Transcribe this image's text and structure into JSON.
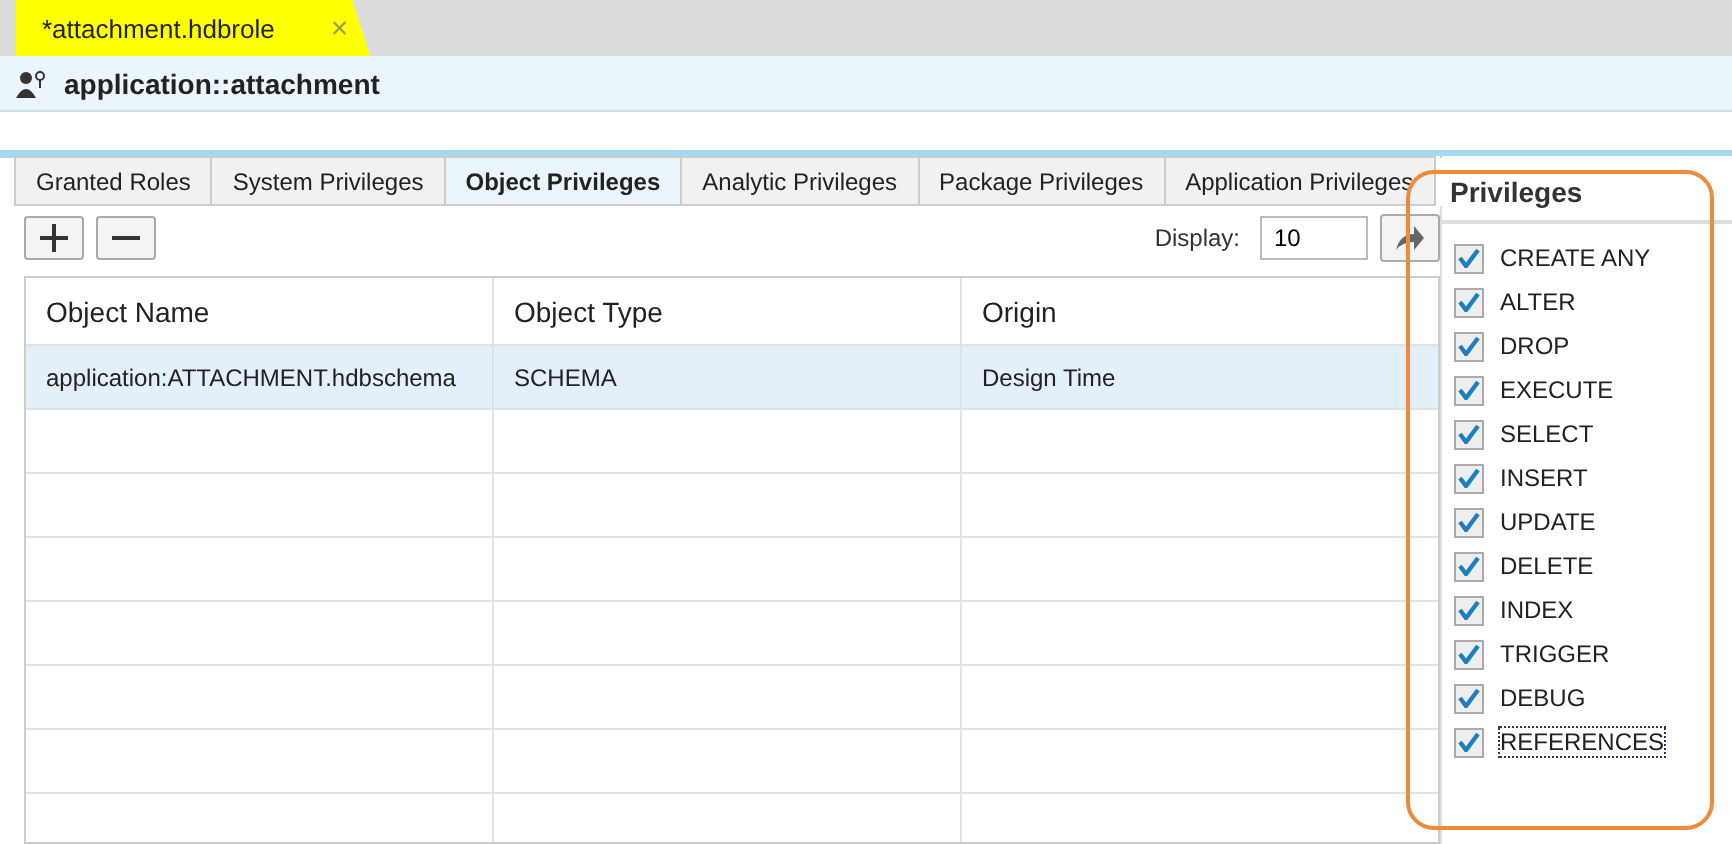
{
  "editor_tab": {
    "title": "*attachment.hdbrole",
    "close": "×"
  },
  "header": {
    "title": "application::attachment"
  },
  "tabs": [
    {
      "label": "Granted Roles",
      "selected": false
    },
    {
      "label": "System Privileges",
      "selected": false
    },
    {
      "label": "Object Privileges",
      "selected": true
    },
    {
      "label": "Analytic Privileges",
      "selected": false
    },
    {
      "label": "Package Privileges",
      "selected": false
    },
    {
      "label": "Application Privileges",
      "selected": false
    }
  ],
  "toolbar": {
    "display_label": "Display:",
    "display_value": "10"
  },
  "table": {
    "columns": [
      "Object Name",
      "Object Type",
      "Origin"
    ],
    "rows": [
      {
        "cells": [
          "application:ATTACHMENT.hdbschema",
          "SCHEMA",
          "Design Time"
        ],
        "selected": true
      }
    ]
  },
  "privileges": {
    "title": "Privileges",
    "items": [
      {
        "label": "CREATE ANY",
        "checked": true,
        "focused": false
      },
      {
        "label": "ALTER",
        "checked": true,
        "focused": false
      },
      {
        "label": "DROP",
        "checked": true,
        "focused": false
      },
      {
        "label": "EXECUTE",
        "checked": true,
        "focused": false
      },
      {
        "label": "SELECT",
        "checked": true,
        "focused": false
      },
      {
        "label": "INSERT",
        "checked": true,
        "focused": false
      },
      {
        "label": "UPDATE",
        "checked": true,
        "focused": false
      },
      {
        "label": "DELETE",
        "checked": true,
        "focused": false
      },
      {
        "label": "INDEX",
        "checked": true,
        "focused": false
      },
      {
        "label": "TRIGGER",
        "checked": true,
        "focused": false
      },
      {
        "label": "DEBUG",
        "checked": true,
        "focused": false
      },
      {
        "label": "REFERENCES",
        "checked": true,
        "focused": true
      }
    ]
  }
}
